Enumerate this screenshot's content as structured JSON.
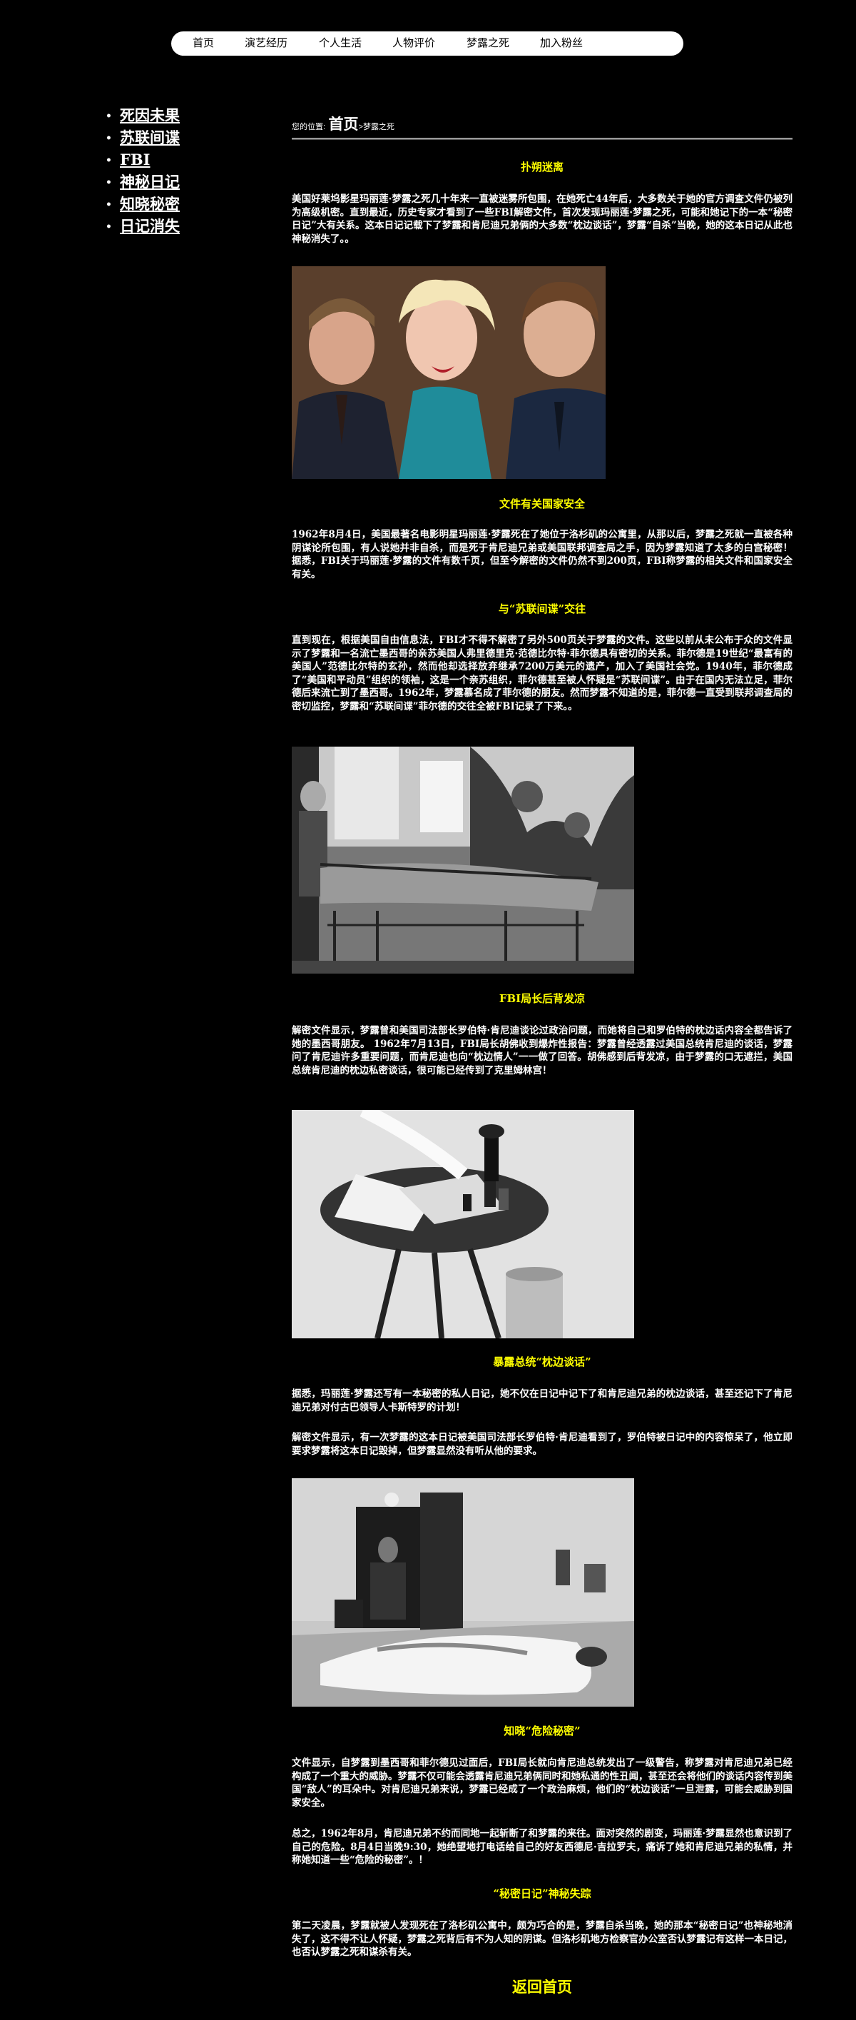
{
  "nav": [
    "首页",
    "演艺经历",
    "个人生活",
    "人物评价",
    "梦露之死",
    "加入粉丝"
  ],
  "sidebar": [
    "死因未果",
    "苏联间谍",
    "FBI",
    "神秘日记",
    "知晓秘密",
    "日记消失"
  ],
  "breadcrumb": {
    "label": "您的位置:",
    "home": "首页",
    "separator": ">",
    "current": "梦露之死"
  },
  "sections": [
    {
      "title": "扑朔迷离",
      "paragraphs": [
        "美国好莱坞影星玛丽莲·梦露之死几十年来一直被迷雾所包围，在她死亡44年后，大多数关于她的官方调查文件仍被列为高级机密。直到最近，历史专家才看到了一些FBI解密文件，首次发现玛丽莲·梦露之死，可能和她记下的一本“秘密日记”大有关系。这本日记记载下了梦露和肯尼迪兄弟俩的大多数“枕边谈话”，梦露“自杀”当晚，她的这本日记从此也神秘消失了。。"
      ]
    },
    {
      "title": "文件有关国家安全",
      "paragraphs": [
        "1962年8月4日，美国最著名电影明星玛丽莲·梦露死在了她位于洛杉矶的公寓里，从那以后，梦露之死就一直被各种阴谋论所包围，有人说她并非自杀，而是死于肯尼迪兄弟或美国联邦调查局之手，因为梦露知道了太多的白宫秘密！ 据悉，FBI关于玛丽莲·梦露的文件有数千页，但至今解密的文件仍然不到200页，FBI称梦露的相关文件和国家安全有关。"
      ]
    },
    {
      "title": "与“苏联间谍”交往",
      "paragraphs": [
        "直到现在，根据美国自由信息法，FBI才不得不解密了另外500页关于梦露的文件。这些以前从未公布于众的文件显示了梦露和一名流亡墨西哥的亲苏美国人弗里德里克·范德比尔特·菲尔德具有密切的关系。菲尔德是19世纪“最富有的美国人”范德比尔特的玄孙，然而他却选择放弃继承7200万美元的遗产，加入了美国社会党。1940年，菲尔德成了“美国和平动员”组织的领袖，这是一个亲苏组织，菲尔德甚至被人怀疑是“苏联间谍”。由于在国内无法立足，菲尔德后来流亡到了墨西哥。1962年，梦露慕名成了菲尔德的朋友。然而梦露不知道的是，菲尔德一直受到联邦调查局的密切监控，梦露和“苏联间谍”菲尔德的交往全被FBI记录了下来。。"
      ]
    },
    {
      "title": "FBI局长后背发凉",
      "paragraphs": [
        "解密文件显示，梦露曾和美国司法部长罗伯特·肯尼迪谈论过政治问题，而她将自己和罗伯特的枕边话内容全都告诉了她的墨西哥朋友。 1962年7月13日，FBI局长胡佛收到爆炸性报告：梦露曾经透露过美国总统肯尼迪的谈话，梦露问了肯尼迪许多重要问题，而肯尼迪也向“枕边情人”一一做了回答。胡佛感到后背发凉，由于梦露的口无遮拦，美国总统肯尼迪的枕边私密谈话，很可能已经传到了克里姆林宫！"
      ]
    },
    {
      "title": "暴露总统“枕边谈话”",
      "paragraphs": [
        "据悉，玛丽莲·梦露还写有一本秘密的私人日记，她不仅在日记中记下了和肯尼迪兄弟的枕边谈话，甚至还记下了肯尼迪兄弟对付古巴领导人卡斯特罗的计划！",
        "解密文件显示，有一次梦露的这本日记被美国司法部长罗伯特·肯尼迪看到了，罗伯特被日记中的内容惊呆了，他立即要求梦露将这本日记毁掉，但梦露显然没有听从他的要求。"
      ]
    },
    {
      "title": "知晓“危险秘密”",
      "paragraphs": [
        "文件显示，自梦露到墨西哥和菲尔德见过面后，FBI局长就向肯尼迪总统发出了一级警告，称梦露对肯尼迪兄弟已经构成了一个重大的威胁。梦露不仅可能会透露肯尼迪兄弟俩同时和她私通的性丑闻，甚至还会将他们的谈话内容传到美国“敌人”的耳朵中。对肯尼迪兄弟来说，梦露已经成了一个政治麻烦，他们的“枕边谈话”一旦泄露，可能会威胁到国家安全。",
        "总之，1962年8月，肯尼迪兄弟不约而同地一起斩断了和梦露的来往。面对突然的剧变，玛丽莲·梦露显然也意识到了自己的危险。8月4日当晚9:30，她绝望地打电话给自己的好友西德尼·吉拉罗夫，痛诉了她和肯尼迪兄弟的私情，并称她知道一些“危险的秘密”。！"
      ]
    },
    {
      "title": "“秘密日记”神秘失踪",
      "paragraphs": [
        "第二天凌晨，梦露就被人发现死在了洛杉矶公寓中，颇为巧合的是，梦露自杀当晚，她的那本“秘密日记”也神秘地消失了，这不得不让人怀疑，梦露之死背后有不为人知的阴谋。但洛杉矶地方检察官办公室否认梦露记有这样一本日记，也否认梦露之死和谋杀有关。"
      ]
    }
  ],
  "back_link": "返回首页",
  "colors": {
    "background": "#000000",
    "text": "#ffffff",
    "heading": "#ffff00",
    "nav_bg": "#ffffff"
  }
}
